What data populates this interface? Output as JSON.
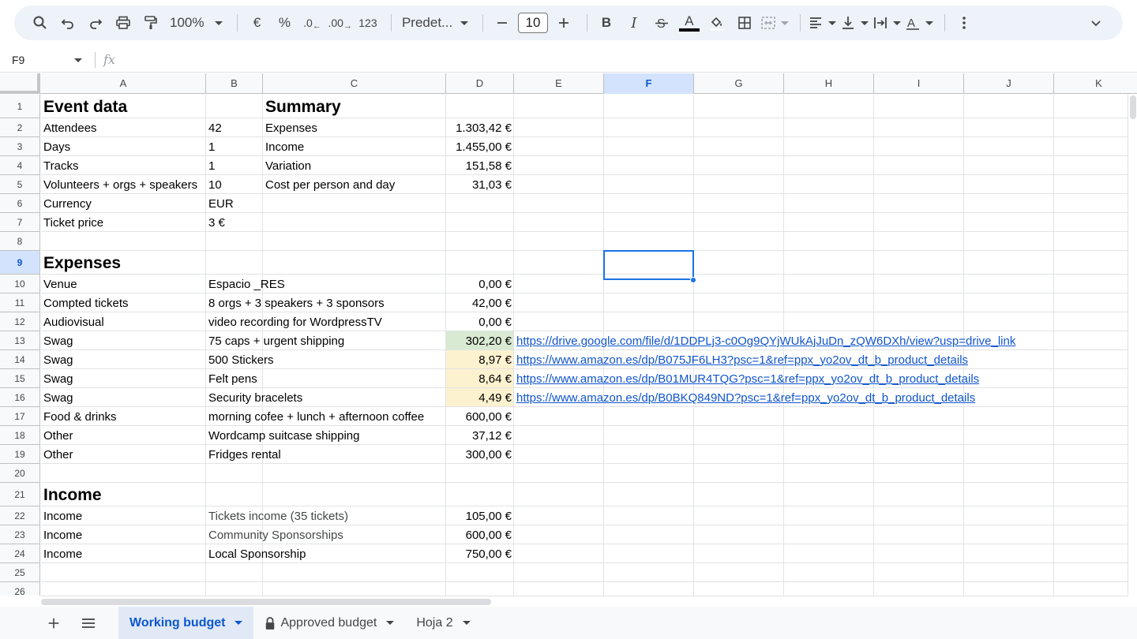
{
  "toolbar": {
    "zoom": "100%",
    "currency": "€",
    "percent": "%",
    "decrease_decimals": ".0",
    "increase_decimals": ".00",
    "number_format": "123",
    "font_name": "Predet...",
    "font_size": "10"
  },
  "formula_bar": {
    "cell_ref": "F9",
    "fx": "fx"
  },
  "columns": [
    "A",
    "B",
    "C",
    "D",
    "E",
    "F",
    "G",
    "H",
    "I",
    "J",
    "K"
  ],
  "rows": [
    "1",
    "2",
    "3",
    "4",
    "5",
    "6",
    "7",
    "8",
    "9",
    "10",
    "11",
    "12",
    "13",
    "14",
    "15",
    "16",
    "17",
    "18",
    "19",
    "20",
    "21",
    "22",
    "23",
    "24",
    "25",
    "26"
  ],
  "selected_cell": {
    "col": "F",
    "row": "9"
  },
  "cells": {
    "A1": "Event data",
    "C1": "Summary",
    "A2": "Attendees",
    "B2": "42",
    "C2": "Expenses",
    "D2": "1.303,42 €",
    "A3": "Days",
    "B3": "1",
    "C3": "Income",
    "D3": "1.455,00 €",
    "A4": "Tracks",
    "B4": "1",
    "C4": "Variation",
    "D4": "151,58 €",
    "A5": "Volunteers + orgs + speakers",
    "B5": "10",
    "C5": "Cost per person and day",
    "D5": "31,03 €",
    "A6": "Currency",
    "B6": "EUR",
    "A7": "Ticket price",
    "B7": "3 €",
    "A9": "Expenses",
    "A10": "Venue",
    "B10": "Espacio _RES",
    "D10": "0,00 €",
    "A11": "Compted tickets",
    "B11": "8 orgs + 3 speakers + 3 sponsors",
    "D11": "42,00 €",
    "A12": "Audiovisual",
    "B12": "video recording for WordpressTV",
    "D12": "0,00 €",
    "A13": "Swag",
    "B13": "75 caps + urgent shipping",
    "D13": "302,20 €",
    "E13": "https://drive.google.com/file/d/1DDPLj3-c0Og9QYjWUkAjJuDn_zQW6DXh/view?usp=drive_link",
    "A14": "Swag",
    "B14": "500 Stickers",
    "D14": "8,97 €",
    "E14": "https://www.amazon.es/dp/B075JF6LH3?psc=1&ref=ppx_yo2ov_dt_b_product_details",
    "A15": "Swag",
    "B15": "Felt pens",
    "D15": "8,64 €",
    "E15": "https://www.amazon.es/dp/B01MUR4TQG?psc=1&ref=ppx_yo2ov_dt_b_product_details",
    "A16": "Swag",
    "B16": "Security bracelets",
    "D16": "4,49 €",
    "E16": "https://www.amazon.es/dp/B0BKQ849ND?psc=1&ref=ppx_yo2ov_dt_b_product_details",
    "A17": "Food & drinks",
    "B17": "morning cofee + lunch + afternoon coffee",
    "D17": "600,00 €",
    "A18": "Other",
    "B18": "Wordcamp suitcase shipping",
    "D18": "37,12 €",
    "A19": "Other",
    "B19": "Fridges rental",
    "D19": "300,00 €",
    "A21": "Income",
    "A22": "Income",
    "B22": "Tickets income (35 tickets)",
    "D22": "105,00 €",
    "A23": "Income",
    "B23": "Community Sponsorships",
    "D23": "600,00 €",
    "A24": "Income",
    "B24": "Local Sponsorship",
    "D24": "750,00 €"
  },
  "highlight_colors": {
    "green": "#d9ead3",
    "yellow": "#fdf2d0",
    "link": "#1155cc",
    "selection": "#1a73e8"
  },
  "sheet_tabs": [
    {
      "label": "Working budget",
      "active": true,
      "locked": false
    },
    {
      "label": "Approved budget",
      "active": false,
      "locked": true
    },
    {
      "label": "Hoja 2",
      "active": false,
      "locked": false
    }
  ]
}
